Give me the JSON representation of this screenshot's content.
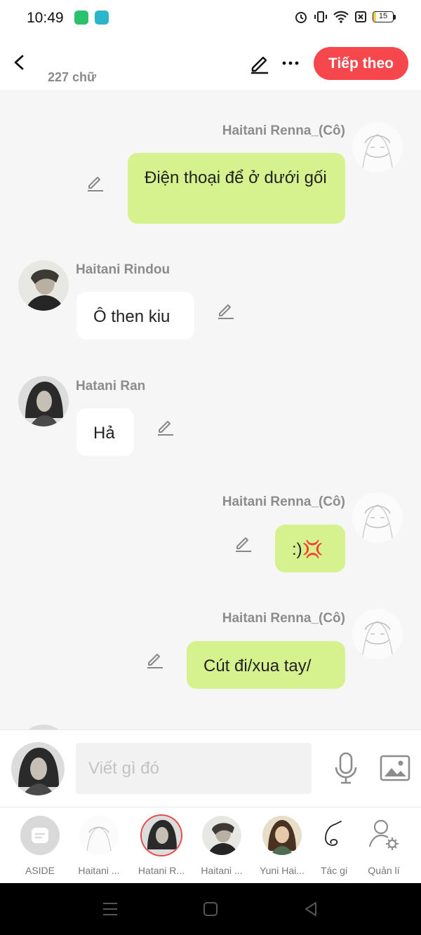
{
  "status_bar": {
    "time": "10:49",
    "battery": "15",
    "battery_level_percent": 15,
    "icons": [
      "green-app-icon",
      "cyan-app-icon",
      "alarm-icon",
      "vibrate-icon",
      "wifi-icon",
      "no-sim-icon",
      "battery-icon"
    ]
  },
  "header": {
    "word_count": "227 chữ",
    "next_label": "Tiếp theo",
    "icons": [
      "back-arrow-icon",
      "pen-icon",
      "more-icon"
    ]
  },
  "messages": [
    {
      "sender": "Haitani Renna_(Cô)",
      "text": "Điện thoại để ở dưới gối",
      "side": "right"
    },
    {
      "sender": "Haitani Rindou",
      "text": "Ô then kiu",
      "side": "left"
    },
    {
      "sender": "Hatani Ran",
      "text": "Hả",
      "side": "left"
    },
    {
      "sender": "Haitani Renna_(Cô)",
      "text": ":)💢",
      "side": "right"
    },
    {
      "sender": "Haitani Renna_(Cô)",
      "text": "Cút đi/xua tay/",
      "side": "right"
    }
  ],
  "compose": {
    "placeholder": "Viết gì đó",
    "icons": [
      "microphone-icon",
      "image-icon"
    ]
  },
  "characters": [
    {
      "label": "ASIDE"
    },
    {
      "label": "Haitani ..."
    },
    {
      "label": "Hatani R..."
    },
    {
      "label": "Haitani ..."
    },
    {
      "label": "Yuni Hai..."
    },
    {
      "label": "Tác gi"
    },
    {
      "label": "Quản lí"
    }
  ],
  "colors": {
    "accent": "#f5474c",
    "bubble_right": "#d6f28f",
    "bubble_left": "#ffffff",
    "background": "#f6f6f6"
  }
}
